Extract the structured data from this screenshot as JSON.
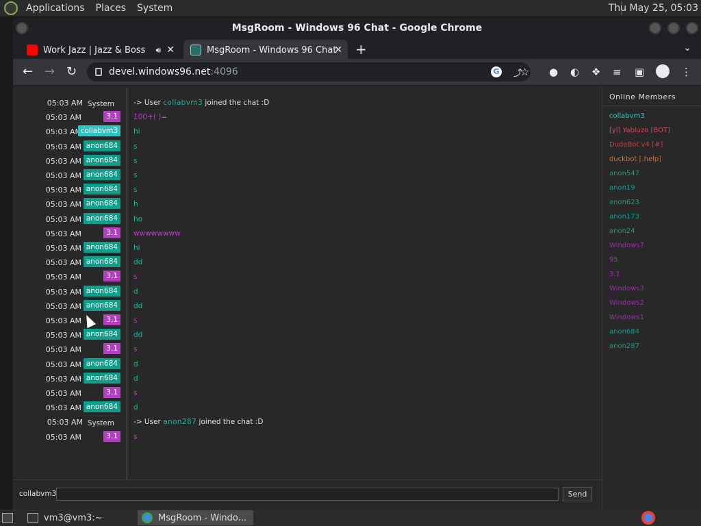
{
  "top_panel": {
    "menus": [
      "Applications",
      "Places",
      "System"
    ],
    "clock": "Thu May 25, 05:03"
  },
  "window": {
    "title": "MsgRoom - Windows 96 Chat - Google Chrome"
  },
  "tabs": [
    {
      "label": "Work Jazz | Jazz & Bossa N",
      "favicon": "youtube-icon",
      "audio": "speaker-icon"
    },
    {
      "label": "MsgRoom - Windows 96 Chat",
      "favicon": "msgroom-icon"
    }
  ],
  "address": {
    "host": "devel.windows96.net",
    "port": ":4096"
  },
  "colors": {
    "system": "#e0e0e0",
    "collabvm3": "#2ec4c4",
    "anon684": "#0f9e8a",
    "three_one": "#b63ec4",
    "teal_text": "#1fb39c",
    "purple_text": "#b63ec4"
  },
  "messages": [
    {
      "time": "05:03 AM",
      "nick": "System",
      "kind": "sys",
      "text": "-> User ",
      "user": "collabvm3",
      "tail": " joined the chat :D"
    },
    {
      "time": "05:03 AM",
      "nick": "3.1",
      "kind": "p",
      "text": "100+( )="
    },
    {
      "time": "05:03 AM",
      "nick": "collabvm3",
      "kind": "c",
      "text": "hi"
    },
    {
      "time": "05:03 AM",
      "nick": "anon684",
      "kind": "t",
      "text": "s"
    },
    {
      "time": "05:03 AM",
      "nick": "anon684",
      "kind": "t",
      "text": "s"
    },
    {
      "time": "05:03 AM",
      "nick": "anon684",
      "kind": "t",
      "text": "s"
    },
    {
      "time": "05:03 AM",
      "nick": "anon684",
      "kind": "t",
      "text": "s"
    },
    {
      "time": "05:03 AM",
      "nick": "anon684",
      "kind": "t",
      "text": "h"
    },
    {
      "time": "05:03 AM",
      "nick": "anon684",
      "kind": "t",
      "text": "ho"
    },
    {
      "time": "05:03 AM",
      "nick": "3.1",
      "kind": "p",
      "text": "wwwwwwww"
    },
    {
      "time": "05:03 AM",
      "nick": "anon684",
      "kind": "t",
      "text": "hi"
    },
    {
      "time": "05:03 AM",
      "nick": "anon684",
      "kind": "t",
      "text": "dd"
    },
    {
      "time": "05:03 AM",
      "nick": "3.1",
      "kind": "p",
      "text": "s"
    },
    {
      "time": "05:03 AM",
      "nick": "anon684",
      "kind": "t",
      "text": "d"
    },
    {
      "time": "05:03 AM",
      "nick": "anon684",
      "kind": "t",
      "text": "dd"
    },
    {
      "time": "05:03 AM",
      "nick": "3.1",
      "kind": "p",
      "text": "s"
    },
    {
      "time": "05:03 AM",
      "nick": "anon684",
      "kind": "t",
      "text": "dd"
    },
    {
      "time": "05:03 AM",
      "nick": "3.1",
      "kind": "p",
      "text": "s"
    },
    {
      "time": "05:03 AM",
      "nick": "anon684",
      "kind": "t",
      "text": "d"
    },
    {
      "time": "05:03 AM",
      "nick": "anon684",
      "kind": "t",
      "text": "d"
    },
    {
      "time": "05:03 AM",
      "nick": "3.1",
      "kind": "p",
      "text": "s"
    },
    {
      "time": "05:03 AM",
      "nick": "anon684",
      "kind": "t",
      "text": "d"
    },
    {
      "time": "05:03 AM",
      "nick": "System",
      "kind": "sys",
      "text": "-> User ",
      "user": "anon287",
      "tail": " joined the chat :D"
    },
    {
      "time": "05:03 AM",
      "nick": "3.1",
      "kind": "p",
      "text": "s"
    }
  ],
  "members": {
    "header": "Online Members",
    "list": [
      {
        "name": "collabvm3",
        "color": "#2ec4c4"
      },
      {
        "name": "[yl] Yabluzo [BOT]",
        "color": "#d6455b"
      },
      {
        "name": "DudeBot v4 [#]",
        "color": "#e0303e"
      },
      {
        "name": "duckbot [.help]",
        "color": "#c9714a"
      },
      {
        "name": "anon547",
        "color": "#0f9e8a"
      },
      {
        "name": "anon19",
        "color": "#0f9e8a"
      },
      {
        "name": "anon623",
        "color": "#0f9e8a"
      },
      {
        "name": "anon173",
        "color": "#0f9e8a"
      },
      {
        "name": "anon24",
        "color": "#0f9e8a"
      },
      {
        "name": "Windows7",
        "color": "#9b2fa8"
      },
      {
        "name": "95",
        "color": "#9b2fa8"
      },
      {
        "name": "3.1",
        "color": "#9b2fa8"
      },
      {
        "name": "Windows3",
        "color": "#9b2fa8"
      },
      {
        "name": "Windows2",
        "color": "#9b2fa8"
      },
      {
        "name": "Windows1",
        "color": "#9b2fa8"
      },
      {
        "name": "anon684",
        "color": "#0f9e8a"
      },
      {
        "name": "anon287",
        "color": "#0f9e8a"
      }
    ]
  },
  "composer": {
    "username": "collabvm3",
    "input_value": "",
    "send_label": "Send"
  },
  "taskbar": {
    "items": [
      {
        "label": "vm3@vm3:~",
        "icon": "terminal-icon"
      },
      {
        "label": "MsgRoom - Windo...",
        "icon": "chrome-icon"
      }
    ]
  }
}
